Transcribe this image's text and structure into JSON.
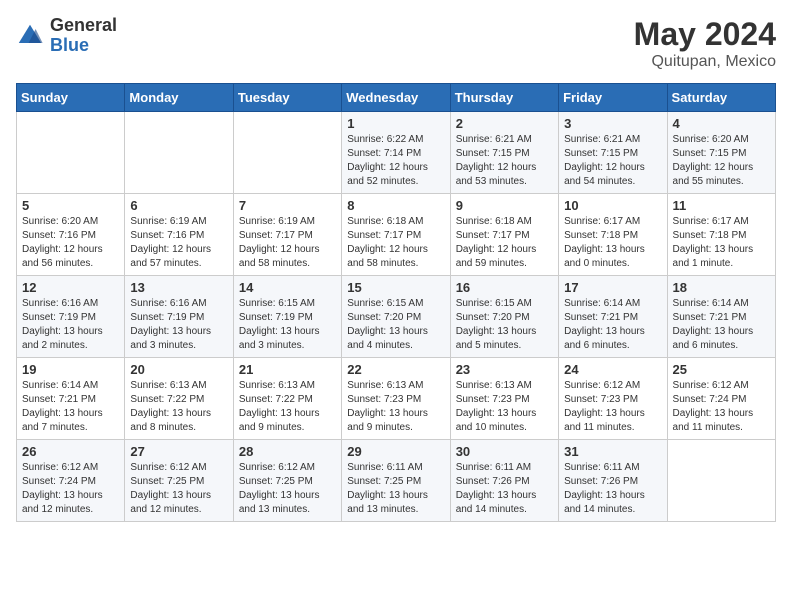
{
  "logo": {
    "general": "General",
    "blue": "Blue"
  },
  "title": {
    "month": "May 2024",
    "location": "Quitupan, Mexico"
  },
  "days_of_week": [
    "Sunday",
    "Monday",
    "Tuesday",
    "Wednesday",
    "Thursday",
    "Friday",
    "Saturday"
  ],
  "weeks": [
    [
      {
        "day": "",
        "info": ""
      },
      {
        "day": "",
        "info": ""
      },
      {
        "day": "",
        "info": ""
      },
      {
        "day": "1",
        "info": "Sunrise: 6:22 AM\nSunset: 7:14 PM\nDaylight: 12 hours\nand 52 minutes."
      },
      {
        "day": "2",
        "info": "Sunrise: 6:21 AM\nSunset: 7:15 PM\nDaylight: 12 hours\nand 53 minutes."
      },
      {
        "day": "3",
        "info": "Sunrise: 6:21 AM\nSunset: 7:15 PM\nDaylight: 12 hours\nand 54 minutes."
      },
      {
        "day": "4",
        "info": "Sunrise: 6:20 AM\nSunset: 7:15 PM\nDaylight: 12 hours\nand 55 minutes."
      }
    ],
    [
      {
        "day": "5",
        "info": "Sunrise: 6:20 AM\nSunset: 7:16 PM\nDaylight: 12 hours\nand 56 minutes."
      },
      {
        "day": "6",
        "info": "Sunrise: 6:19 AM\nSunset: 7:16 PM\nDaylight: 12 hours\nand 57 minutes."
      },
      {
        "day": "7",
        "info": "Sunrise: 6:19 AM\nSunset: 7:17 PM\nDaylight: 12 hours\nand 58 minutes."
      },
      {
        "day": "8",
        "info": "Sunrise: 6:18 AM\nSunset: 7:17 PM\nDaylight: 12 hours\nand 58 minutes."
      },
      {
        "day": "9",
        "info": "Sunrise: 6:18 AM\nSunset: 7:17 PM\nDaylight: 12 hours\nand 59 minutes."
      },
      {
        "day": "10",
        "info": "Sunrise: 6:17 AM\nSunset: 7:18 PM\nDaylight: 13 hours\nand 0 minutes."
      },
      {
        "day": "11",
        "info": "Sunrise: 6:17 AM\nSunset: 7:18 PM\nDaylight: 13 hours\nand 1 minute."
      }
    ],
    [
      {
        "day": "12",
        "info": "Sunrise: 6:16 AM\nSunset: 7:19 PM\nDaylight: 13 hours\nand 2 minutes."
      },
      {
        "day": "13",
        "info": "Sunrise: 6:16 AM\nSunset: 7:19 PM\nDaylight: 13 hours\nand 3 minutes."
      },
      {
        "day": "14",
        "info": "Sunrise: 6:15 AM\nSunset: 7:19 PM\nDaylight: 13 hours\nand 3 minutes."
      },
      {
        "day": "15",
        "info": "Sunrise: 6:15 AM\nSunset: 7:20 PM\nDaylight: 13 hours\nand 4 minutes."
      },
      {
        "day": "16",
        "info": "Sunrise: 6:15 AM\nSunset: 7:20 PM\nDaylight: 13 hours\nand 5 minutes."
      },
      {
        "day": "17",
        "info": "Sunrise: 6:14 AM\nSunset: 7:21 PM\nDaylight: 13 hours\nand 6 minutes."
      },
      {
        "day": "18",
        "info": "Sunrise: 6:14 AM\nSunset: 7:21 PM\nDaylight: 13 hours\nand 6 minutes."
      }
    ],
    [
      {
        "day": "19",
        "info": "Sunrise: 6:14 AM\nSunset: 7:21 PM\nDaylight: 13 hours\nand 7 minutes."
      },
      {
        "day": "20",
        "info": "Sunrise: 6:13 AM\nSunset: 7:22 PM\nDaylight: 13 hours\nand 8 minutes."
      },
      {
        "day": "21",
        "info": "Sunrise: 6:13 AM\nSunset: 7:22 PM\nDaylight: 13 hours\nand 9 minutes."
      },
      {
        "day": "22",
        "info": "Sunrise: 6:13 AM\nSunset: 7:23 PM\nDaylight: 13 hours\nand 9 minutes."
      },
      {
        "day": "23",
        "info": "Sunrise: 6:13 AM\nSunset: 7:23 PM\nDaylight: 13 hours\nand 10 minutes."
      },
      {
        "day": "24",
        "info": "Sunrise: 6:12 AM\nSunset: 7:23 PM\nDaylight: 13 hours\nand 11 minutes."
      },
      {
        "day": "25",
        "info": "Sunrise: 6:12 AM\nSunset: 7:24 PM\nDaylight: 13 hours\nand 11 minutes."
      }
    ],
    [
      {
        "day": "26",
        "info": "Sunrise: 6:12 AM\nSunset: 7:24 PM\nDaylight: 13 hours\nand 12 minutes."
      },
      {
        "day": "27",
        "info": "Sunrise: 6:12 AM\nSunset: 7:25 PM\nDaylight: 13 hours\nand 12 minutes."
      },
      {
        "day": "28",
        "info": "Sunrise: 6:12 AM\nSunset: 7:25 PM\nDaylight: 13 hours\nand 13 minutes."
      },
      {
        "day": "29",
        "info": "Sunrise: 6:11 AM\nSunset: 7:25 PM\nDaylight: 13 hours\nand 13 minutes."
      },
      {
        "day": "30",
        "info": "Sunrise: 6:11 AM\nSunset: 7:26 PM\nDaylight: 13 hours\nand 14 minutes."
      },
      {
        "day": "31",
        "info": "Sunrise: 6:11 AM\nSunset: 7:26 PM\nDaylight: 13 hours\nand 14 minutes."
      },
      {
        "day": "",
        "info": ""
      }
    ]
  ]
}
